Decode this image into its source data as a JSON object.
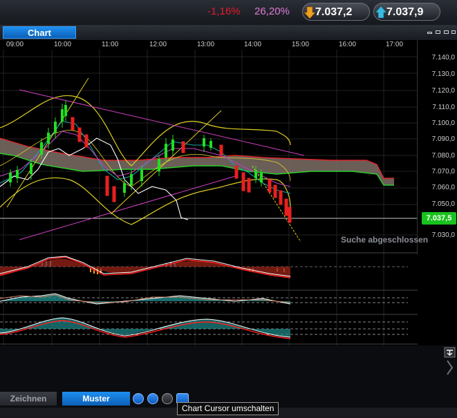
{
  "header": {
    "change_pct": "-1,16%",
    "change_pct2": "26,20%",
    "bid": "7.037,2",
    "ask": "7.037,9",
    "colors": {
      "neg": "#e8192c",
      "pos": "#e07ad8"
    }
  },
  "tab": {
    "label": "Chart"
  },
  "time_axis": [
    "09:00",
    "10:00",
    "11:00",
    "12:00",
    "13:00",
    "14:00",
    "15:00",
    "16:00",
    "17:00"
  ],
  "price_axis": [
    "7.140,0",
    "7.130,0",
    "7.120,0",
    "7.110,0",
    "7.100,0",
    "7.090,0",
    "7.080,0",
    "7.070,0",
    "7.060,0",
    "7.050,0",
    "7.040,0",
    "7.030,0"
  ],
  "current_price": "7.037,5",
  "status": "Suche abgeschlossen",
  "bottom_tabs": {
    "draw": "Zeichnen",
    "pattern": "Muster"
  },
  "tooltip": "Chart Cursor umschalten",
  "icons": [
    "pencil-icon",
    "swap-icon",
    "crosshair-icon",
    "number-icon"
  ]
}
